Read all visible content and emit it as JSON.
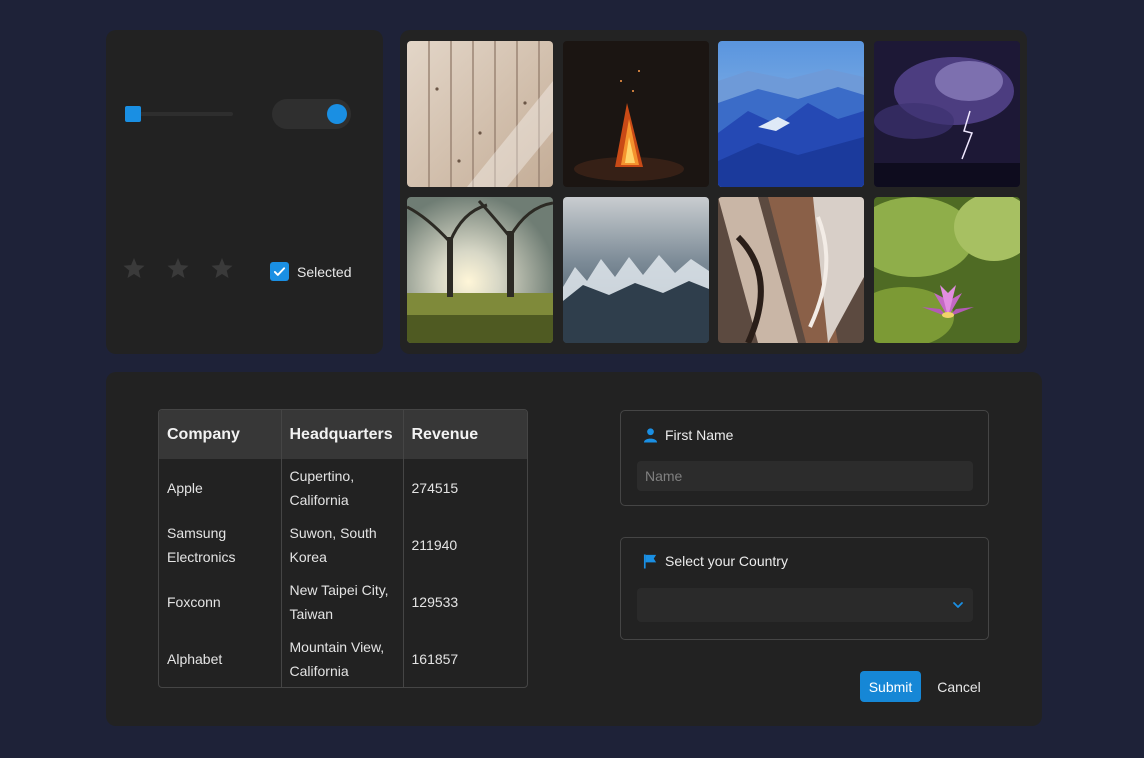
{
  "controls": {
    "slider_value": 0,
    "toggle_on": true,
    "rating": {
      "value": 0,
      "max": 3
    },
    "checkbox": {
      "checked": true,
      "label": "Selected"
    }
  },
  "gallery": {
    "photos": [
      {
        "name": "wood-planks-photo"
      },
      {
        "name": "campfire-photo"
      },
      {
        "name": "blue-mountains-photo"
      },
      {
        "name": "lightning-storm-photo"
      },
      {
        "name": "trees-sunset-photo"
      },
      {
        "name": "ice-crystals-photo"
      },
      {
        "name": "metal-sculpture-photo"
      },
      {
        "name": "lotus-flower-photo"
      }
    ]
  },
  "table": {
    "headers": [
      "Company",
      "Headquarters",
      "Revenue"
    ],
    "rows": [
      [
        "Apple",
        "Cupertino, California",
        "274515"
      ],
      [
        "Samsung Electronics",
        "Suwon, South Korea",
        "211940"
      ],
      [
        "Foxconn",
        "New Taipei City, Taiwan",
        "129533"
      ],
      [
        "Alphabet",
        "Mountain View, California",
        "161857"
      ]
    ]
  },
  "form": {
    "first_name_label": "First Name",
    "first_name_placeholder": "Name",
    "first_name_value": "",
    "country_label": "Select your Country",
    "country_value": "",
    "submit_label": "Submit",
    "cancel_label": "Cancel"
  },
  "colors": {
    "accent": "#1a8fe3",
    "background": "#1e2238",
    "panel": "#222222"
  }
}
